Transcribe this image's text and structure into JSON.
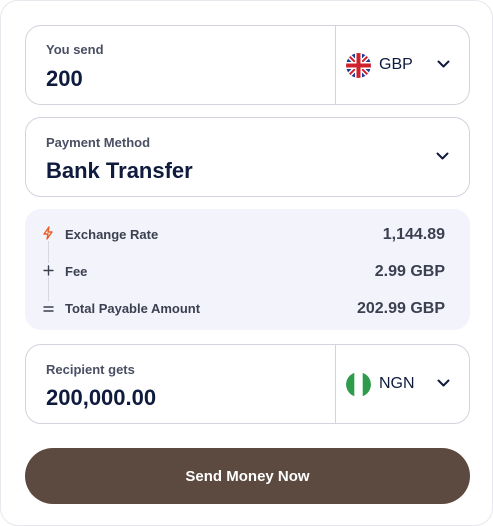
{
  "send": {
    "label": "You send",
    "amount": "200",
    "currency": "GBP",
    "flag_icon": "uk-flag-icon"
  },
  "payment": {
    "label": "Payment Method",
    "value": "Bank Transfer"
  },
  "summary": {
    "rows": [
      {
        "label": "Exchange Rate",
        "value": "1,144.89",
        "icon": "lightning-icon",
        "icon_color": "#e8602c"
      },
      {
        "label": "Fee",
        "value": "2.99 GBP",
        "icon": "plus-icon"
      },
      {
        "label": "Total Payable Amount",
        "value": "202.99 GBP",
        "icon": "equals-icon"
      }
    ]
  },
  "receive": {
    "label": "Recipient gets",
    "amount": "200,000.00",
    "currency": "NGN",
    "flag_icon": "nigeria-flag-icon"
  },
  "action": {
    "label": "Send Money Now"
  },
  "colors": {
    "primary_button": "#5c4a40",
    "text_dark": "#0f1b3d",
    "summary_bg": "#f3f3fb",
    "border": "#d3d3dd"
  }
}
